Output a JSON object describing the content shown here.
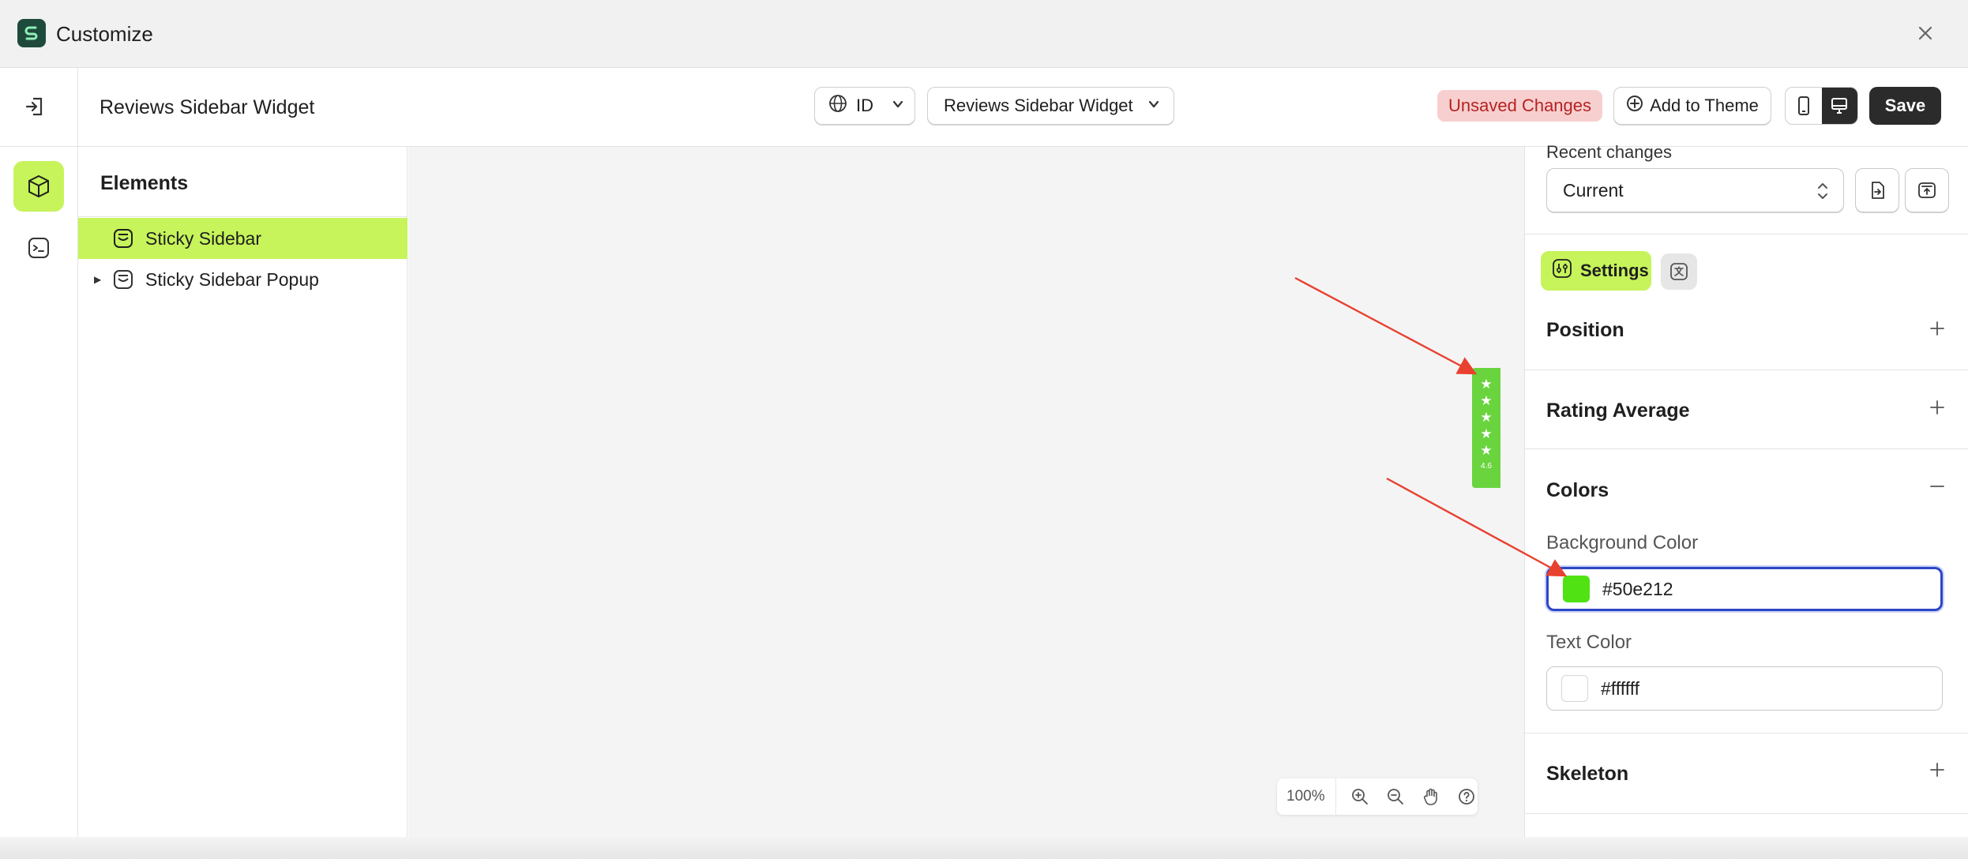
{
  "window": {
    "title": "Customize",
    "close_icon": "close-icon"
  },
  "toolbar": {
    "page_name": "Reviews Sidebar Widget",
    "language": "ID",
    "template": "Reviews Sidebar Widget",
    "unsaved_label": "Unsaved Changes",
    "add_to_theme_label": "Add to Theme",
    "save_label": "Save"
  },
  "rail": {
    "items": [
      {
        "icon": "cube-icon",
        "active": true
      },
      {
        "icon": "terminal-icon",
        "active": false
      }
    ]
  },
  "elements_panel": {
    "heading": "Elements",
    "items": [
      {
        "label": "Sticky Sidebar",
        "selected": true,
        "expandable": false
      },
      {
        "label": "Sticky Sidebar Popup",
        "selected": false,
        "expandable": true
      }
    ]
  },
  "canvas": {
    "widget": {
      "stars": 5,
      "rating_average": "4.6",
      "background_color": "#50e212",
      "text_color": "#ffffff"
    },
    "zoom_level": "100%"
  },
  "settings_panel": {
    "recent_changes_label": "Recent changes",
    "recent_changes_value": "Current",
    "tab_settings": "Settings",
    "sections": {
      "position": "Position",
      "rating_average": "Rating Average",
      "colors": "Colors",
      "skeleton": "Skeleton"
    },
    "colors": {
      "background_label": "Background Color",
      "background_value": "#50e212",
      "text_label": "Text Color",
      "text_value": "#ffffff"
    }
  },
  "theme": {
    "accent": "#c6f45a",
    "dark": "#2b2b2b",
    "unsaved_bg": "#f8cfcf",
    "unsaved_text": "#b42323",
    "annotation_arrow": "#e8412f"
  }
}
